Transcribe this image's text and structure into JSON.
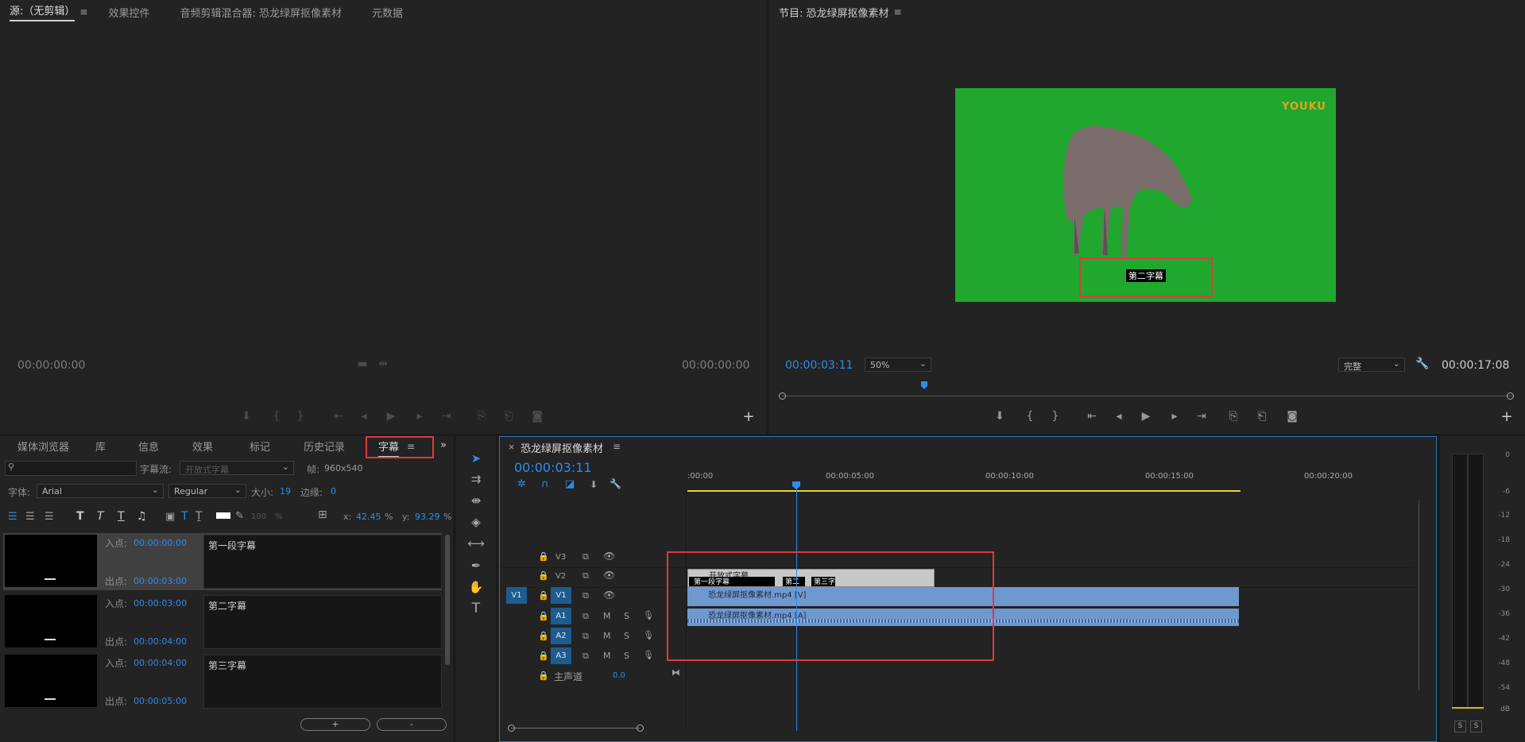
{
  "source_panel": {
    "tabs": [
      "源:（无剪辑）",
      "效果控件",
      "音频剪辑混合器: 恐龙绿屏抠像素材",
      "元数据"
    ],
    "timecode_left": "00:00:00:00",
    "timecode_right": "00:00:00:00"
  },
  "program_panel": {
    "title": "节目: 恐龙绿屏抠像素材",
    "timecode": "00:00:03:11",
    "zoom": "50%",
    "quality": "完整",
    "duration": "00:00:17:08",
    "watermark": "YOUKU",
    "subtitle_overlay": "第二字幕"
  },
  "captions_panel": {
    "tabs": [
      "媒体浏览器",
      "库",
      "信息",
      "效果",
      "标记",
      "历史记录",
      "字幕"
    ],
    "stream_label": "字幕流:",
    "stream_value": "开放式字幕",
    "frame_label": "帧:",
    "frame_value": "960x540",
    "font_label": "字体:",
    "font_value": "Arial",
    "style_value": "Regular",
    "size_label": "大小:",
    "size_value": "19",
    "edge_label": "边缘:",
    "edge_value": "0",
    "opacity_value": "100",
    "pct": "%",
    "x_label": "x:",
    "x_value": "42.45",
    "y_label": "y:",
    "y_value": "93.29",
    "in_label": "入点:",
    "out_label": "出点:",
    "items": [
      {
        "in": "00:00:00:00",
        "out": "00:00:03:00",
        "text": "第一段字幕"
      },
      {
        "in": "00:00:03:00",
        "out": "00:00:04:00",
        "text": "第二字幕"
      },
      {
        "in": "00:00:04:00",
        "out": "00:00:05:00",
        "text": "第三字幕"
      }
    ],
    "add_label": "+",
    "remove_label": "-"
  },
  "timeline": {
    "title": "恐龙绿屏抠像素材",
    "timecode": "00:00:03:11",
    "ruler": [
      ":00:00",
      "00:00:05:00",
      "00:00:10:00",
      "00:00:15:00",
      "00:00:20:00"
    ],
    "video_tracks": [
      "V3",
      "V2",
      "V1"
    ],
    "audio_tracks": [
      "A1",
      "A2",
      "A3"
    ],
    "source_patch": "V1",
    "master_label": "主声道",
    "master_value": "0.0",
    "mute": "M",
    "solo": "S",
    "clips": {
      "caption_track": "开放式字幕",
      "caption_1": "第一段字幕",
      "caption_2": "第二",
      "caption_3": "第三字",
      "video": "恐龙绿屏抠像素材.mp4 [V]",
      "audio": "恐龙绿屏抠像素材.mp4 [A]"
    }
  },
  "meter": {
    "scale": [
      "0",
      "-6",
      "-12",
      "-18",
      "-24",
      "-30",
      "-36",
      "-42",
      "-48",
      "-54",
      "dB"
    ],
    "solo_buttons": [
      "S",
      "S"
    ]
  },
  "colors": {
    "accent_blue": "#2d8ceb",
    "green_screen": "#1fa82d",
    "highlight_red": "#e0393e",
    "video_clip": "#6f98cf"
  }
}
